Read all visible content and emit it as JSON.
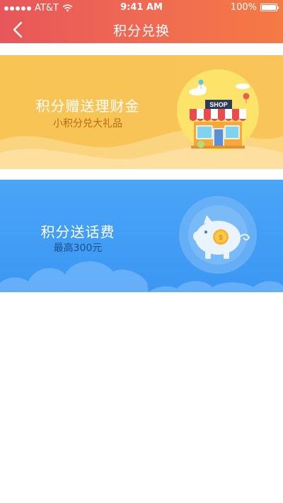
{
  "status_bar": {
    "carrier": "AT&T",
    "time": "9:41 AM",
    "battery_percent": "100%",
    "signal_bars": 5
  },
  "nav": {
    "title": "积分兑换",
    "back_icon": "chevron-left-icon"
  },
  "banners": [
    {
      "title": "积分赠送理财金",
      "subtitle": "小积分兑大礼品",
      "illustration": "shop-icon",
      "shop_sign": "SHOP",
      "background": "#f8c454"
    },
    {
      "title": "积分送话费",
      "subtitle": "最高300元",
      "illustration": "piggy-bank-icon",
      "background": "#4aa5f8"
    }
  ],
  "colors": {
    "header_start": "#e8565a",
    "header_end": "#f57a44",
    "orange_sub_text": "#b86a12",
    "blue_sub_text": "#1d4f8a"
  }
}
